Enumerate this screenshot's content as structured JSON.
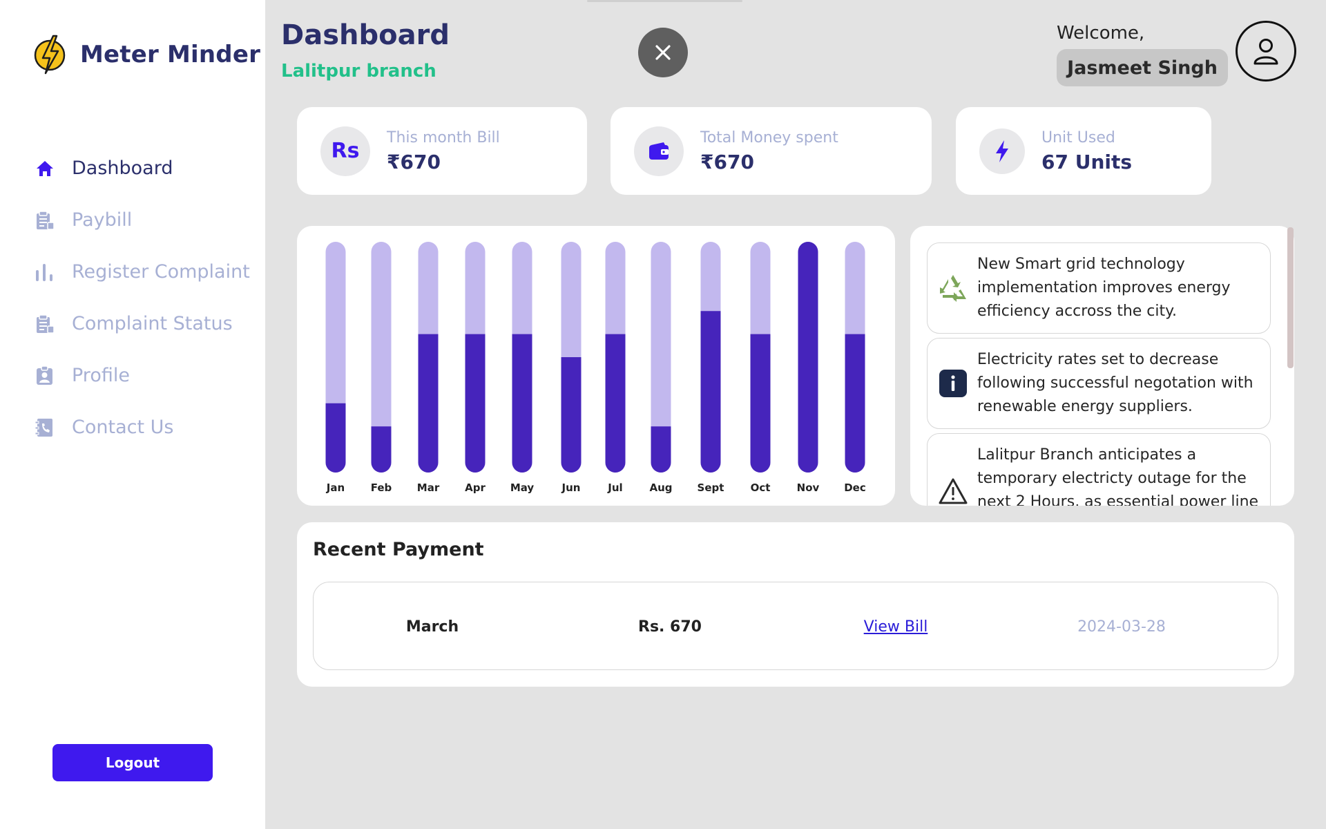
{
  "brand": {
    "name": "Meter Minder",
    "logo_icon": "lightning-bolt-icon"
  },
  "sidebar": {
    "items": [
      {
        "label": "Dashboard",
        "icon": "home-icon",
        "active": true
      },
      {
        "label": "Paybill",
        "icon": "receipt-icon",
        "active": false
      },
      {
        "label": "Register Complaint",
        "icon": "bar-chart-icon",
        "active": false
      },
      {
        "label": "Complaint Status",
        "icon": "clipboard-icon",
        "active": false
      },
      {
        "label": "Profile",
        "icon": "id-badge-icon",
        "active": false
      },
      {
        "label": "Contact Us",
        "icon": "phone-book-icon",
        "active": false
      }
    ],
    "logout_label": "Logout"
  },
  "header": {
    "title": "Dashboard",
    "branch": "Lalitpur branch",
    "welcome": "Welcome,",
    "user_name": "Jasmeet Singh"
  },
  "stats": [
    {
      "label": "This month Bill",
      "value": "₹670",
      "icon": "rupee-icon"
    },
    {
      "label": "Total Money spent",
      "value": "₹670",
      "icon": "wallet-icon"
    },
    {
      "label": "Unit Used",
      "value": "67 Units",
      "icon": "bolt-icon"
    }
  ],
  "chart_data": {
    "type": "bar",
    "categories": [
      "Jan",
      "Feb",
      "Mar",
      "Apr",
      "May",
      "Jun",
      "Jul",
      "Aug",
      "Sept",
      "Oct",
      "Nov",
      "Dec"
    ],
    "values": [
      0.3,
      0.2,
      0.6,
      0.6,
      0.6,
      0.5,
      0.6,
      0.2,
      0.7,
      0.6,
      1.0,
      0.6
    ],
    "ylim": [
      0,
      1
    ],
    "colors": {
      "fill": "#4624bb",
      "track": "#c2b8ee"
    },
    "title": "",
    "xlabel": "",
    "ylabel": ""
  },
  "news": [
    {
      "text": "New Smart grid technology implementation improves energy efficiency accross the city.",
      "icon": "recycle-icon"
    },
    {
      "text": "Electricity rates set to decrease following successful negotation with renewable energy suppliers.",
      "icon": "info-icon"
    },
    {
      "text": "Lalitpur Branch anticipates a temporary electricty outage for the next 2 Hours, as essential power line",
      "icon": "warning-icon"
    }
  ],
  "recent_payment": {
    "title": "Recent Payment",
    "rows": [
      {
        "month": "March",
        "amount": "Rs. 670",
        "link": "View Bill",
        "date": "2024-03-28"
      }
    ]
  },
  "colors": {
    "accent": "#3f19ee",
    "branch_green": "#22c08a",
    "navy": "#2b2f6b"
  }
}
